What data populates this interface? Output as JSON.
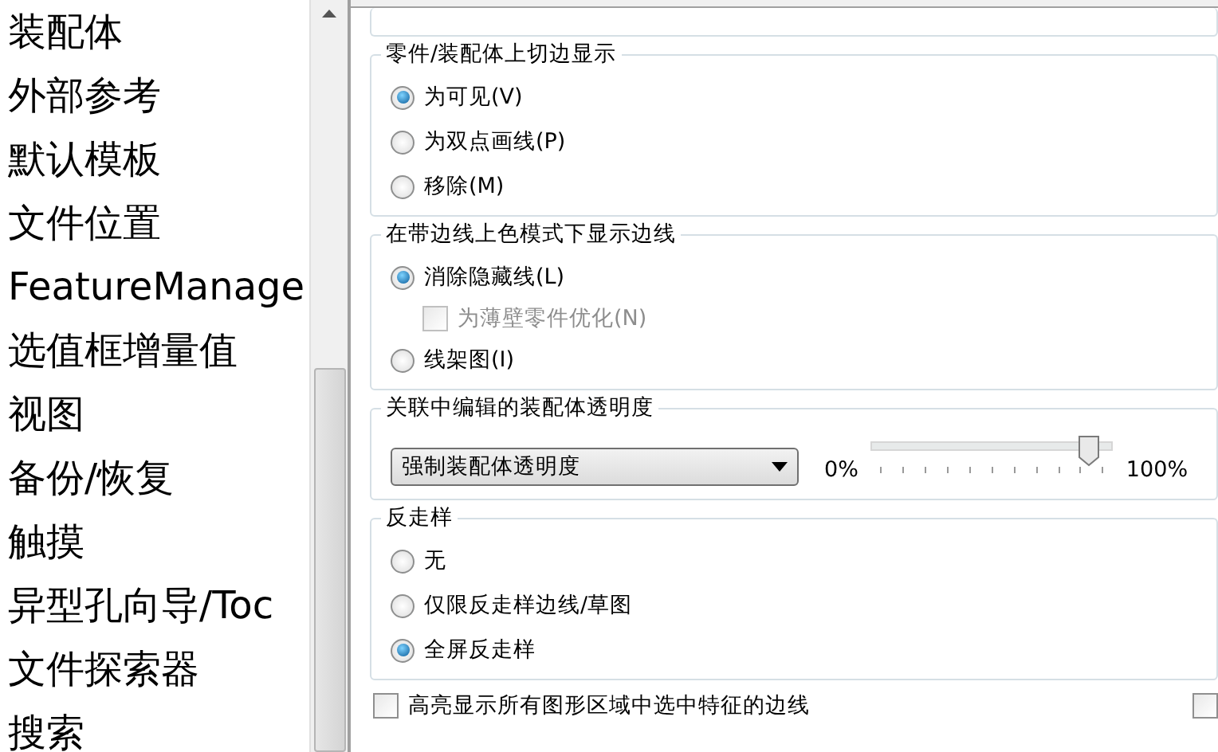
{
  "sidebar": {
    "items": [
      {
        "label": "装配体"
      },
      {
        "label": "外部参考"
      },
      {
        "label": "默认模板"
      },
      {
        "label": "文件位置"
      },
      {
        "label": "FeatureManage"
      },
      {
        "label": "选值框增量值"
      },
      {
        "label": "视图"
      },
      {
        "label": "备份/恢复"
      },
      {
        "label": "触摸"
      },
      {
        "label": "异型孔向导/Toc"
      },
      {
        "label": "文件探索器"
      },
      {
        "label": "搜索"
      }
    ]
  },
  "groups": [
    {
      "title": "零件/装配体上切边显示",
      "options": [
        {
          "kind": "radio",
          "label": "为可见(V)",
          "selected": true,
          "disabled": false
        },
        {
          "kind": "radio",
          "label": "为双点画线(P)",
          "selected": false,
          "disabled": false
        },
        {
          "kind": "radio",
          "label": "移除(M)",
          "selected": false,
          "disabled": false
        }
      ]
    },
    {
      "title": "在带边线上色模式下显示边线",
      "options": [
        {
          "kind": "radio",
          "label": "消除隐藏线(L)",
          "selected": true,
          "disabled": false
        },
        {
          "kind": "checkbox",
          "label": "为薄壁零件优化(N)",
          "checked": false,
          "disabled": true
        },
        {
          "kind": "radio",
          "label": "线架图(I)",
          "selected": false,
          "disabled": false
        }
      ]
    },
    {
      "title": "关联中编辑的装配体透明度",
      "dropdown": {
        "value": "强制装配体透明度"
      },
      "slider": {
        "level": 0.9,
        "min_label": "0%",
        "max_label": "100%"
      }
    },
    {
      "title": "反走样",
      "options": [
        {
          "kind": "radio",
          "label": "无",
          "selected": false,
          "disabled": false
        },
        {
          "kind": "radio",
          "label": "仅限反走样边线/草图",
          "selected": false,
          "disabled": false
        },
        {
          "kind": "radio",
          "label": "全屏反走样",
          "selected": true,
          "disabled": false
        }
      ]
    }
  ],
  "bottom_checkboxes": [
    {
      "label": "高亮显示所有图形区域中选中特征的边线",
      "checked": false
    },
    {
      "checked": false
    }
  ]
}
